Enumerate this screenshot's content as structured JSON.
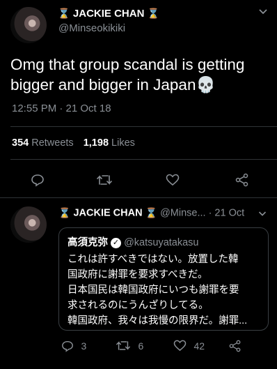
{
  "main_tweet": {
    "display_name": "JACKIE CHAN",
    "handle": "@Minseokikiki",
    "text": "Omg that group scandal is getting bigger and bigger in Japan",
    "emoji": "💀",
    "timestamp": "12:55 PM · 21 Oct 18",
    "retweets_count": "354",
    "retweets_label": "Retweets",
    "likes_count": "1,198",
    "likes_label": "Likes"
  },
  "reply_tweet": {
    "display_name": "JACKIE CHAN",
    "handle_date": "@Minse... · 21 Oct",
    "quote": {
      "author": "高須克弥",
      "handle": "@katsuyatakasu",
      "lines": [
        "これは許すべきではない。放置した韓",
        "国政府に謝罪を要求すべきだ。",
        "日本国民は韓国政府にいつも謝罪を要",
        "求されるのにうんざりしてる。",
        "韓国政府、我々は我慢の限界だ。謝罪..."
      ]
    },
    "replies_count": "3",
    "retweets_count": "6",
    "likes_count": "42"
  },
  "colors": {
    "background": "#000000",
    "muted": "#8a8f95",
    "hourglass": "#e8b949",
    "divider": "#2f3336"
  },
  "icons": [
    "hourglass-icon",
    "chevron-down-icon",
    "reply-icon",
    "retweet-icon",
    "like-icon",
    "share-icon",
    "verified-icon",
    "skull-emoji"
  ]
}
